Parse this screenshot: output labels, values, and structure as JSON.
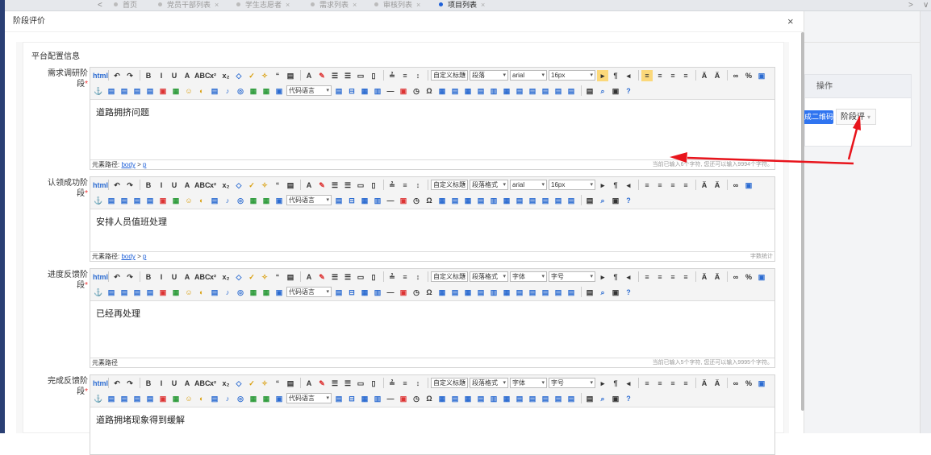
{
  "topbar": {
    "nav_prev": "<",
    "nav_next": ">",
    "nav_more": "∨",
    "tabs": [
      {
        "label": "首页",
        "closable": false,
        "active": false
      },
      {
        "label": "党员干部列表",
        "closable": true,
        "active": false
      },
      {
        "label": "学生志愿者",
        "closable": true,
        "active": false
      },
      {
        "label": "需求列表",
        "closable": true,
        "active": false
      },
      {
        "label": "审核列表",
        "closable": true,
        "active": false
      },
      {
        "label": "项目列表",
        "closable": true,
        "active": true
      }
    ],
    "close_glyph": "×"
  },
  "background": {
    "ops_header": "操作",
    "qr_button": "成二维码",
    "stage_button": "阶段评"
  },
  "modal": {
    "title": "阶段评价",
    "close_glyph": "×",
    "section_title": "平台配置信息",
    "fields": [
      {
        "label_line1": "需求调研阶",
        "label_line2": "段",
        "required": "*",
        "font_select": "arial",
        "size_select": "16px",
        "content": "道路拥挤问题",
        "path_label": "元素路径:",
        "path_links": [
          "body",
          "p"
        ],
        "path_sep": ">",
        "count": "当前已输入6个字符, 您还可以输入9994个字符。"
      },
      {
        "label_line1": "认领成功阶",
        "label_line2": "段",
        "required": "*",
        "font_select": "arial",
        "size_select": "16px",
        "content": "安排人员值班处理",
        "path_label": "元素路径:",
        "path_links": [
          "body",
          "p"
        ],
        "path_sep": ">",
        "count": "字数统计"
      },
      {
        "label_line1": "进度反馈阶",
        "label_line2": "段",
        "required": "*",
        "font_select": "字体",
        "size_select": "字号",
        "content": "已经再处理",
        "path_label": "元素路径",
        "path_links": [],
        "path_sep": "",
        "count": "当前已输入5个字符, 您还可以输入9995个字符。"
      },
      {
        "label_line1": "完成反馈阶",
        "label_line2": "段",
        "required": "*",
        "font_select": "字体",
        "size_select": "字号",
        "content": "道路拥堵现象得到缓解",
        "path_label": "",
        "path_links": [],
        "path_sep": "",
        "count": ""
      }
    ],
    "toolbar": {
      "title_select": "自定义标题",
      "para_select_first": "段落",
      "para_select_other": "段落格式",
      "code_select": "代码语言"
    }
  },
  "colors": {
    "accent": "#1e60d8",
    "annotation_arrow": "#e8141c",
    "sidebar": "#2a3f74"
  }
}
